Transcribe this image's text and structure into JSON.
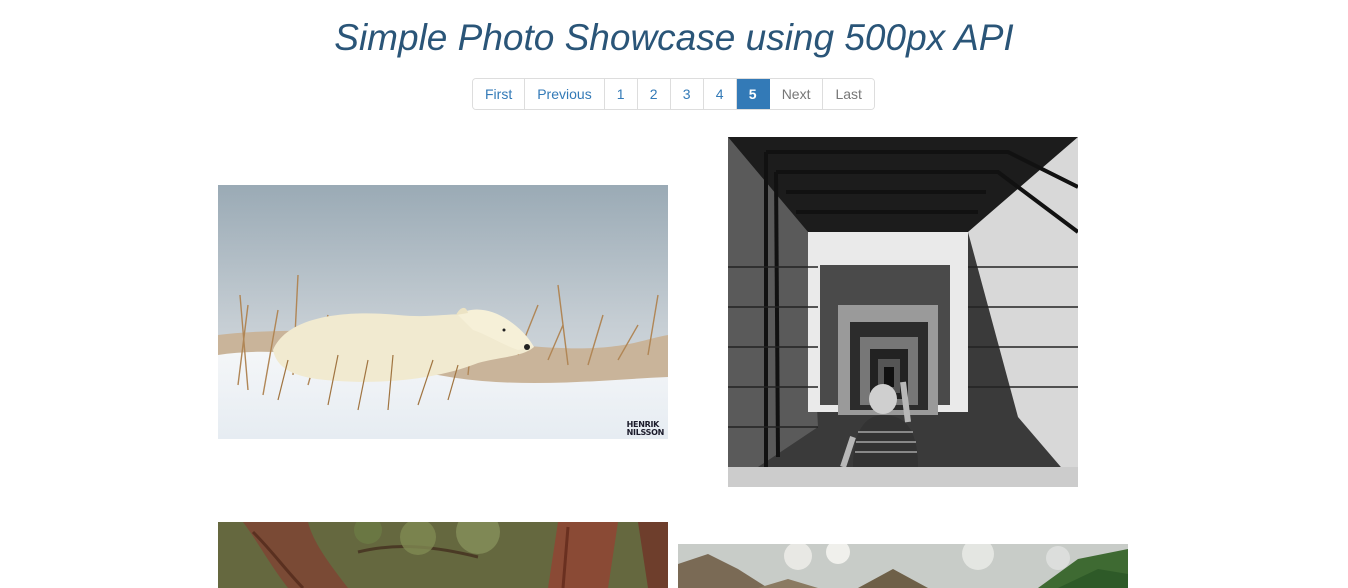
{
  "header": {
    "title": "Simple Photo Showcase using 500px API"
  },
  "pagination": {
    "first_label": "First",
    "previous_label": "Previous",
    "pages": [
      "1",
      "2",
      "3",
      "4",
      "5"
    ],
    "current_page": "5",
    "next_label": "Next",
    "last_label": "Last"
  },
  "photos": {
    "watermark_line1": "HENRIK",
    "watermark_line2": "NILSSON"
  },
  "colors": {
    "title": "#2a5578",
    "link": "#337ab7",
    "active_page_bg": "#337ab7",
    "disabled_text": "#777777"
  }
}
